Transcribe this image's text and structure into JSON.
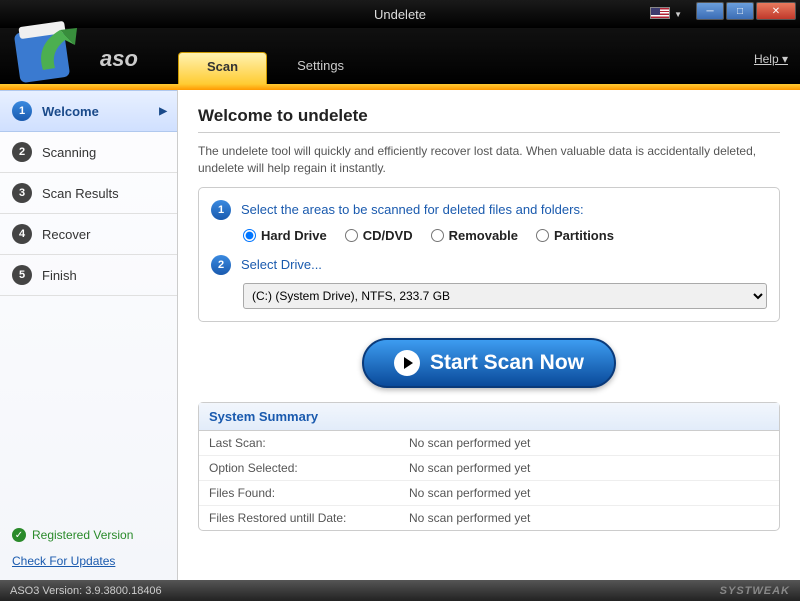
{
  "window": {
    "title": "Undelete",
    "help": "Help  ▾"
  },
  "header": {
    "brand": "aso"
  },
  "tabs": {
    "scan": "Scan",
    "settings": "Settings"
  },
  "sidebar": {
    "items": [
      {
        "num": "1",
        "label": "Welcome"
      },
      {
        "num": "2",
        "label": "Scanning"
      },
      {
        "num": "3",
        "label": "Scan Results"
      },
      {
        "num": "4",
        "label": "Recover"
      },
      {
        "num": "5",
        "label": "Finish"
      }
    ],
    "registered": "Registered Version",
    "updates": "Check For Updates"
  },
  "content": {
    "heading": "Welcome to undelete",
    "description": "The undelete tool will quickly and efficiently recover lost data. When valuable data is accidentally deleted, undelete will help regain it instantly.",
    "step1_label": "Select the areas to be scanned for deleted files and folders:",
    "radios": {
      "hd": "Hard Drive",
      "cd": "CD/DVD",
      "rm": "Removable",
      "pt": "Partitions"
    },
    "step2_label": "Select Drive...",
    "drive_selected": "(C:)  (System Drive), NTFS, 233.7 GB",
    "scan_button": "Start Scan Now"
  },
  "summary": {
    "title": "System Summary",
    "rows": [
      {
        "k": "Last Scan:",
        "v": "No scan performed yet"
      },
      {
        "k": "Option Selected:",
        "v": "No scan performed yet"
      },
      {
        "k": "Files Found:",
        "v": "No scan performed yet"
      },
      {
        "k": "Files Restored untill Date:",
        "v": "No scan performed yet"
      }
    ]
  },
  "status": {
    "version": "ASO3 Version: 3.9.3800.18406",
    "brand": "SYSTWEAK"
  }
}
